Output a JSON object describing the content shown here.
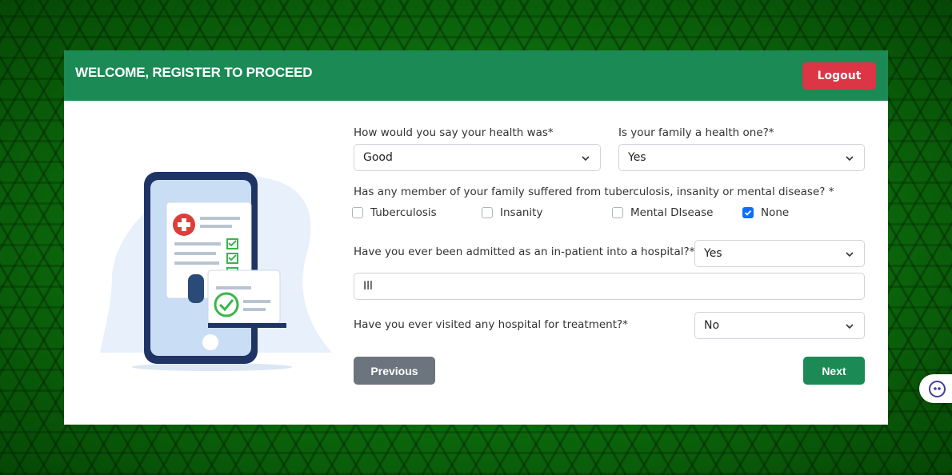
{
  "header": {
    "title": "WELCOME, REGISTER TO PROCEED",
    "logout_label": "Logout"
  },
  "form": {
    "health": {
      "label": "How would you say your health was*",
      "value": "Good"
    },
    "family_health": {
      "label": "Is your family a health one?*",
      "value": "Yes"
    },
    "family_disease": {
      "label": "Has any member of your family suffered from tuberculosis, insanity or mental disease? *",
      "options": [
        {
          "label": "Tuberculosis",
          "checked": false
        },
        {
          "label": "Insanity",
          "checked": false
        },
        {
          "label": "Mental DIsease",
          "checked": false
        },
        {
          "label": "None",
          "checked": true
        }
      ]
    },
    "inpatient": {
      "label": "Have you ever been admitted as an in-patient into a hospital?*",
      "value": "Yes",
      "details_value": "Ill"
    },
    "visited": {
      "label": "Have you ever visited any hospital for treatment?*",
      "value": "No"
    }
  },
  "buttons": {
    "previous": "Previous",
    "next": "Next"
  },
  "icons": [
    "chevron-down-icon",
    "checkmark-icon",
    "medical-report-illustration",
    "chat-bot-icon"
  ],
  "colors": {
    "header_green": "#1b8a55",
    "logout_red": "#dc3545",
    "previous_gray": "#6c757d",
    "checkbox_blue": "#0d6efd"
  }
}
